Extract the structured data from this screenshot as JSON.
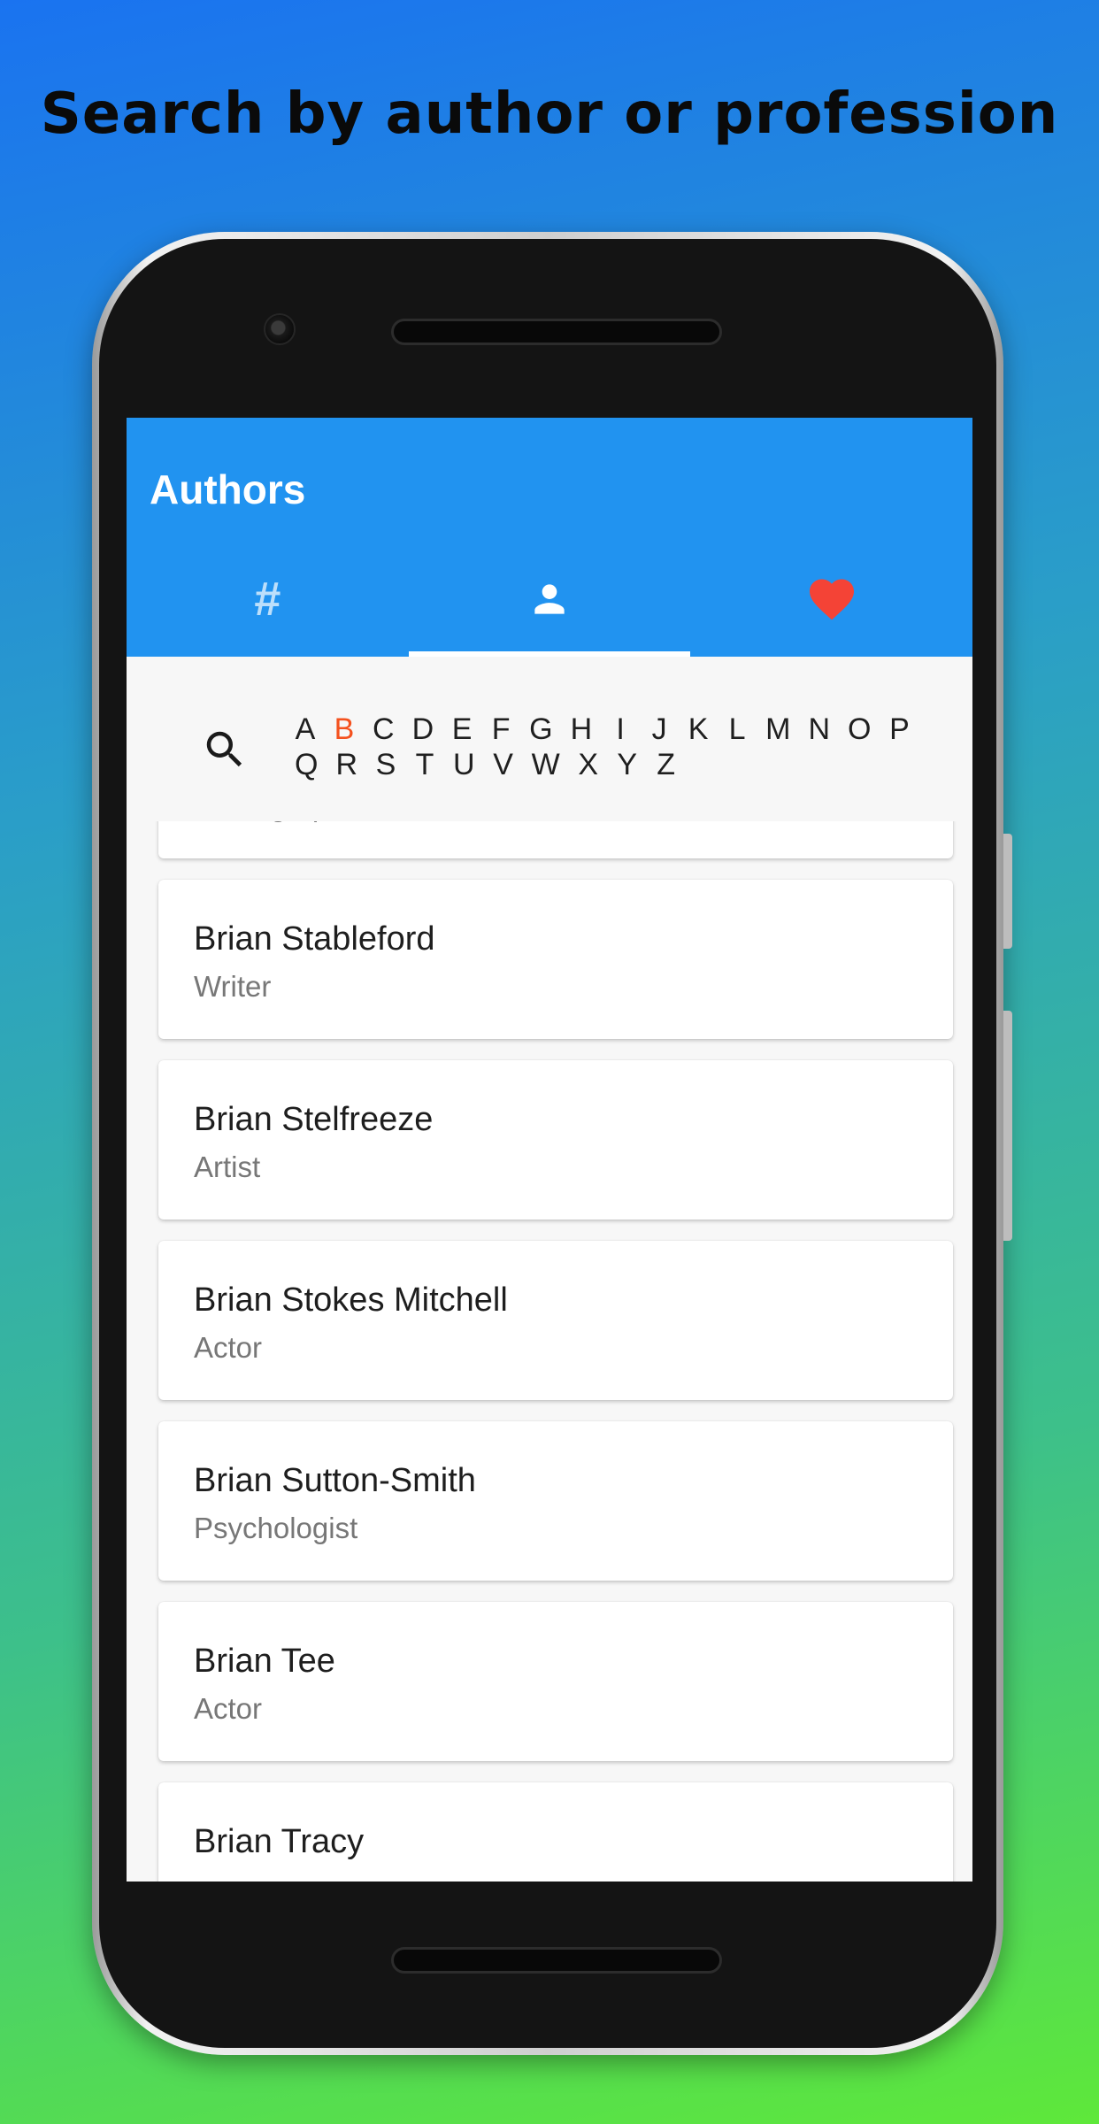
{
  "headline": "Search by author or profession",
  "app": {
    "title": "Authors",
    "tabs": [
      {
        "icon": "hash-icon",
        "label": "#"
      },
      {
        "icon": "person-icon"
      },
      {
        "icon": "heart-icon"
      }
    ],
    "active_tab": 1
  },
  "alphabet": {
    "letters": [
      "A",
      "B",
      "C",
      "D",
      "E",
      "F",
      "G",
      "H",
      "I",
      "J",
      "K",
      "L",
      "M",
      "N",
      "O",
      "P",
      "Q",
      "R",
      "S",
      "T",
      "U",
      "V",
      "W",
      "X",
      "Y",
      "Z"
    ],
    "selected": "B"
  },
  "authors": [
    {
      "name": "",
      "profession": "Photographer"
    },
    {
      "name": "Brian Stableford",
      "profession": "Writer"
    },
    {
      "name": "Brian Stelfreeze",
      "profession": "Artist"
    },
    {
      "name": "Brian Stokes Mitchell",
      "profession": "Actor"
    },
    {
      "name": "Brian Sutton-Smith",
      "profession": "Psychologist"
    },
    {
      "name": "Brian Tee",
      "profession": "Actor"
    },
    {
      "name": "Brian Tracy",
      "profession": ""
    }
  ],
  "colors": {
    "appbar": "#2193f0",
    "selected_letter": "#f4511e",
    "heart": "#f44336"
  }
}
